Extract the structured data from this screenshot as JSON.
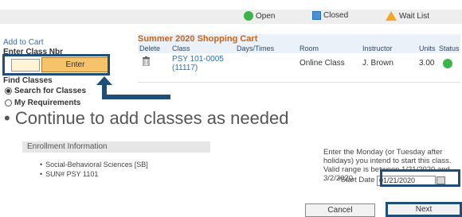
{
  "legend": {
    "open": "Open",
    "closed": "Closed",
    "wait_list": "Wait List"
  },
  "left_panel": {
    "add_to_cart": "Add to Cart",
    "enter_class_nbr": "Enter Class Nbr",
    "enter_button": "Enter",
    "find_classes": "Find Classes",
    "search_for_classes": "Search for Classes",
    "my_requirements": "My Requirements"
  },
  "cart": {
    "title": "Summer 2020 Shopping Cart",
    "headers": [
      "Delete",
      "Class",
      "Days/Times",
      "Room",
      "Instructor",
      "Units",
      "Status"
    ],
    "rows": [
      {
        "class_line1": "PSY 101-0005",
        "class_line2": "(11117)",
        "days_times": "",
        "room": "Online Class",
        "instructor": "J. Brown",
        "units": "3.00",
        "status": "open"
      }
    ]
  },
  "bullet_text": "Continue to add classes as needed",
  "enrollment": {
    "header": "Enrollment Information",
    "items": [
      "Social-Behavioral Sciences [SB]",
      "SUN# PSY 1101"
    ]
  },
  "start_date": {
    "instructions": "Enter the Monday (or Tuesday after holidays) you intend to start this class. Valid range is between 1/21/2020 and 3/2/2020.",
    "label": "*Start Date",
    "value": "01/21/2020"
  },
  "buttons": {
    "cancel": "Cancel",
    "next": "Next"
  },
  "colors": {
    "open": "#3bb54a",
    "closed": "#4a90d9",
    "wait_list": "#f5a623",
    "highlight": "#1f4e79",
    "cart_title": "#c8631a"
  }
}
